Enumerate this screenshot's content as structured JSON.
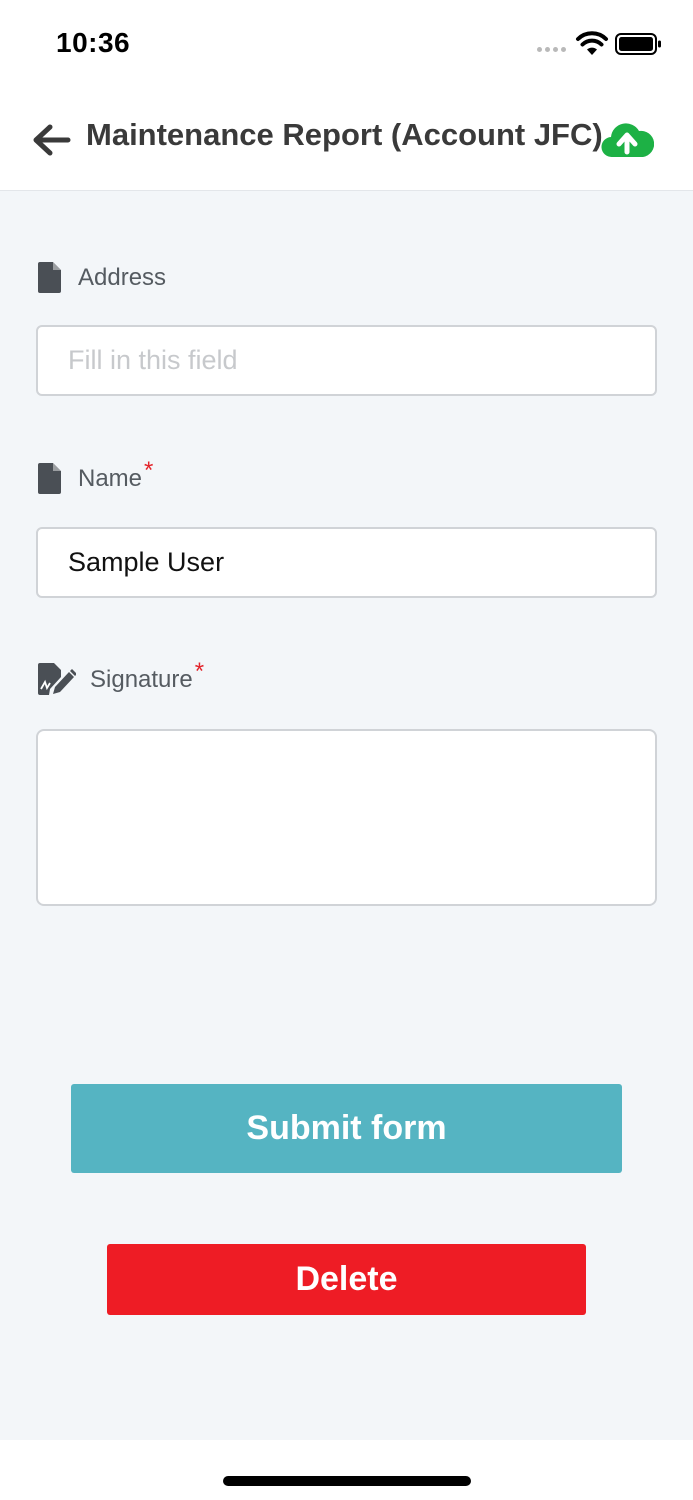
{
  "status_bar": {
    "time": "10:36",
    "icons": [
      "cellular-dots-icon",
      "wifi-icon",
      "battery-icon"
    ]
  },
  "header": {
    "title": "Maintenance Report (Account JFC)",
    "back_icon": "arrow-left-icon",
    "upload_icon": "cloud-upload-icon"
  },
  "form": {
    "fields": [
      {
        "label": "Address",
        "icon": "document-icon",
        "required": false,
        "value": "",
        "placeholder": "Fill in this field"
      },
      {
        "label": "Name",
        "icon": "document-icon",
        "required": true,
        "required_mark": "*",
        "value": "Sample User",
        "placeholder": ""
      },
      {
        "label": "Signature",
        "icon": "signature-icon",
        "required": true,
        "required_mark": "*"
      }
    ],
    "submit_label": "Submit form",
    "delete_label": "Delete"
  },
  "colors": {
    "accent_green": "#1db145",
    "submit_bg": "#55b4c2",
    "delete_bg": "#ee1c25",
    "required": "#e3242b",
    "content_bg": "#f3f6f9"
  }
}
